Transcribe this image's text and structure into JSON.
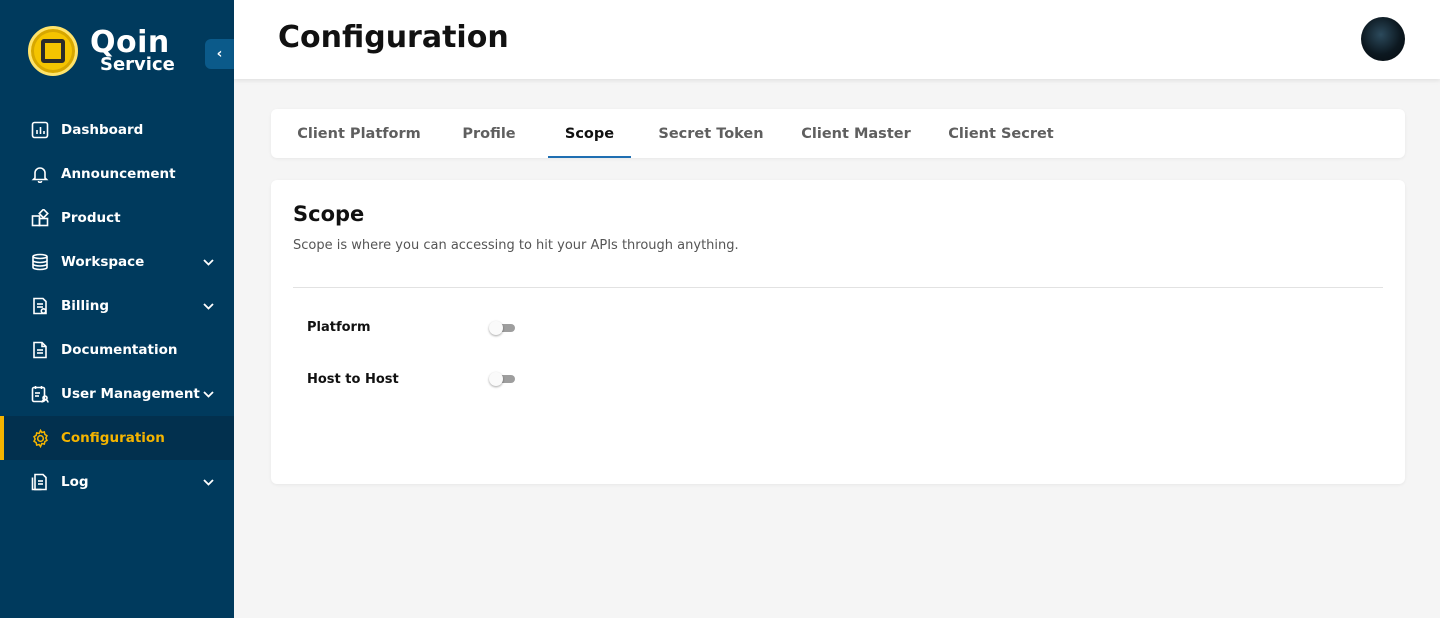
{
  "brand": {
    "name": "Qoin",
    "sub": "Service",
    "primary_color": "#003a5d",
    "accent_color": "#f5b400"
  },
  "sidebar": {
    "collapse_icon": "chevron-left-icon",
    "items": [
      {
        "label": "Dashboard",
        "icon": "dashboard-icon",
        "has_submenu": false,
        "active": false
      },
      {
        "label": "Announcement",
        "icon": "bell-icon",
        "has_submenu": false,
        "active": false
      },
      {
        "label": "Product",
        "icon": "product-icon",
        "has_submenu": false,
        "active": false
      },
      {
        "label": "Workspace",
        "icon": "database-icon",
        "has_submenu": true,
        "active": false
      },
      {
        "label": "Billing",
        "icon": "billing-icon",
        "has_submenu": true,
        "active": false
      },
      {
        "label": "Documentation",
        "icon": "document-icon",
        "has_submenu": false,
        "active": false
      },
      {
        "label": "User Management",
        "icon": "user-management-icon",
        "has_submenu": true,
        "active": false
      },
      {
        "label": "Configuration",
        "icon": "gear-icon",
        "has_submenu": false,
        "active": true
      },
      {
        "label": "Log",
        "icon": "log-icon",
        "has_submenu": true,
        "active": false
      }
    ]
  },
  "header": {
    "title": "Configuration"
  },
  "tabs": [
    {
      "label": "Client Platform",
      "active": false
    },
    {
      "label": "Profile",
      "active": false
    },
    {
      "label": "Scope",
      "active": true
    },
    {
      "label": "Secret Token",
      "active": false
    },
    {
      "label": "Client Master",
      "active": false
    },
    {
      "label": "Client Secret",
      "active": false
    }
  ],
  "scope": {
    "title": "Scope",
    "description": "Scope is where you can accessing to hit your APIs through anything.",
    "rows": [
      {
        "label": "Platform",
        "enabled": false
      },
      {
        "label": "Host to Host",
        "enabled": false
      }
    ]
  }
}
